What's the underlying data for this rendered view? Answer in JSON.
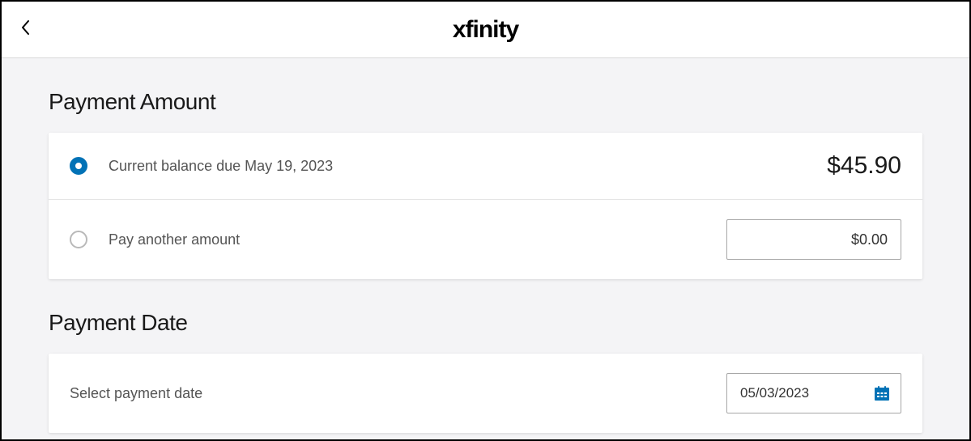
{
  "header": {
    "brand": "xfinity"
  },
  "payment_amount": {
    "title": "Payment Amount",
    "options": {
      "current_balance": {
        "label": "Current balance due May 19, 2023",
        "amount": "$45.90",
        "selected": true
      },
      "other": {
        "label": "Pay another amount",
        "value": "$0.00",
        "selected": false
      }
    }
  },
  "payment_date": {
    "title": "Payment Date",
    "label": "Select payment date",
    "value": "05/03/2023"
  }
}
